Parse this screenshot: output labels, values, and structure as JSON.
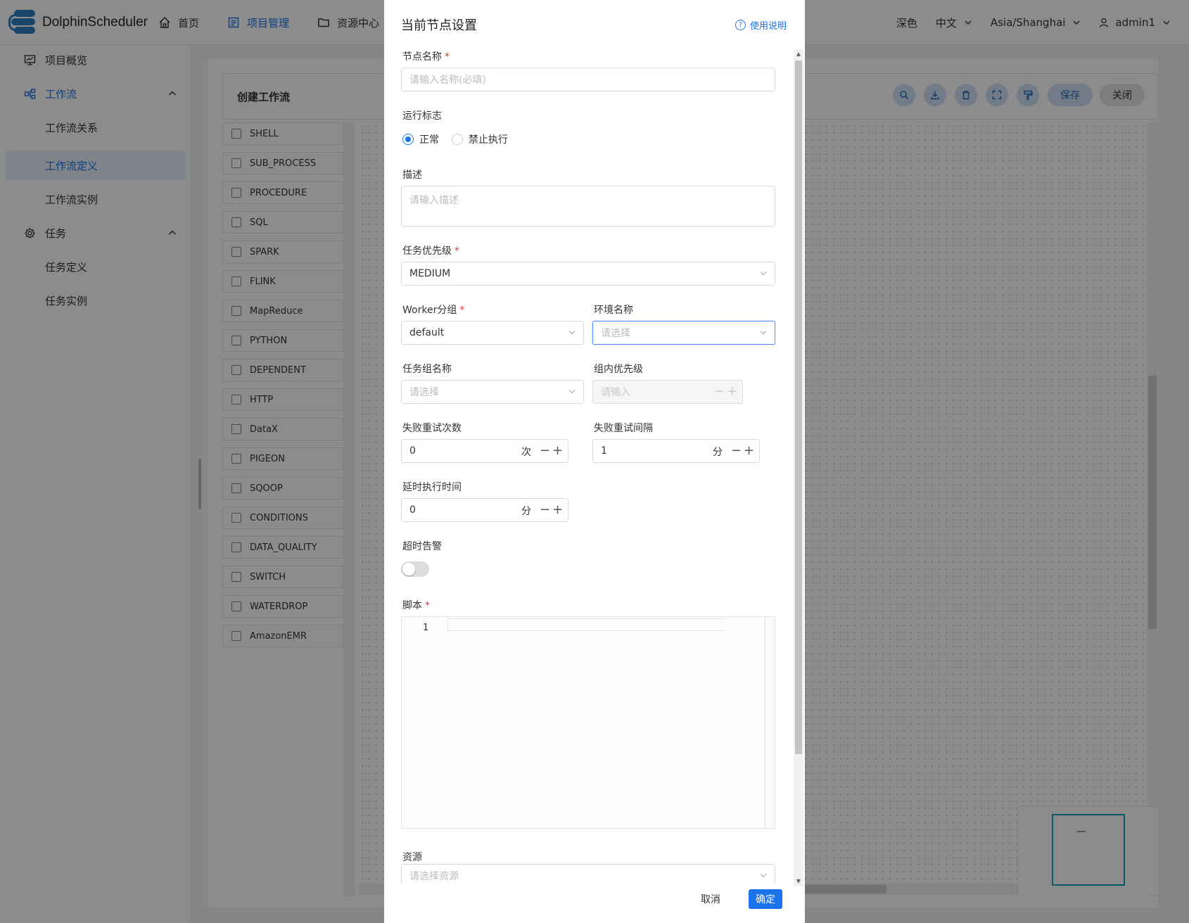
{
  "app": {
    "logo_text": "DolphinScheduler"
  },
  "top_nav": {
    "items": [
      {
        "label": "首页",
        "icon": "home-icon"
      },
      {
        "label": "项目管理",
        "icon": "project-icon"
      },
      {
        "label": "资源中心",
        "icon": "folder-icon"
      }
    ]
  },
  "top_right": {
    "theme": "深色",
    "language": "中文",
    "timezone": "Asia/Shanghai",
    "user": "admin1"
  },
  "sidebar": {
    "overview": "项目概览",
    "workflow": "工作流",
    "workflow_children": [
      "工作流关系",
      "工作流定义",
      "工作流实例"
    ],
    "task": "任务",
    "task_children": [
      "任务定义",
      "任务实例"
    ]
  },
  "workflow": {
    "title": "创建工作流",
    "save_label": "保存",
    "close_label": "关闭",
    "tool_icons": [
      "search-icon",
      "download-icon",
      "delete-icon",
      "fullscreen-icon",
      "format-icon"
    ]
  },
  "palette": [
    "SHELL",
    "SUB_PROCESS",
    "PROCEDURE",
    "SQL",
    "SPARK",
    "FLINK",
    "MapReduce",
    "PYTHON",
    "DEPENDENT",
    "HTTP",
    "DataX",
    "PIGEON",
    "SQOOP",
    "CONDITIONS",
    "DATA_QUALITY",
    "SWITCH",
    "WATERDROP",
    "AmazonEMR"
  ],
  "drawer": {
    "title": "当前节点设置",
    "help": "使用说明",
    "node_name": {
      "label": "节点名称",
      "placeholder": "请输入名称(必填)"
    },
    "run_flag": {
      "label": "运行标志",
      "option_normal": "正常",
      "option_forbid": "禁止执行",
      "selected": "正常"
    },
    "description": {
      "label": "描述",
      "placeholder": "请输入描述"
    },
    "priority": {
      "label": "任务优先级",
      "value": "MEDIUM"
    },
    "worker_group": {
      "label": "Worker分组",
      "value": "default"
    },
    "environment": {
      "label": "环境名称",
      "placeholder": "请选择"
    },
    "task_group": {
      "label": "任务组名称",
      "placeholder": "请选择"
    },
    "group_priority": {
      "label": "组内优先级",
      "placeholder": "请输入"
    },
    "retry_times": {
      "label": "失败重试次数",
      "value": "0",
      "unit": "次"
    },
    "retry_interval": {
      "label": "失败重试间隔",
      "value": "1",
      "unit": "分"
    },
    "delay_time": {
      "label": "延时执行时间",
      "value": "0",
      "unit": "分"
    },
    "timeout_alarm": {
      "label": "超时告警",
      "enabled": false
    },
    "script": {
      "label": "脚本",
      "line_number": "1"
    },
    "resources": {
      "label": "资源",
      "placeholder": "请选择资源"
    },
    "cancel_label": "取消",
    "confirm_label": "确定"
  },
  "colors": {
    "accent": "#1a73e8",
    "required": "#e03434",
    "tool_button": "#cfe2f7",
    "minimap_viewport": "#17a2b8"
  }
}
